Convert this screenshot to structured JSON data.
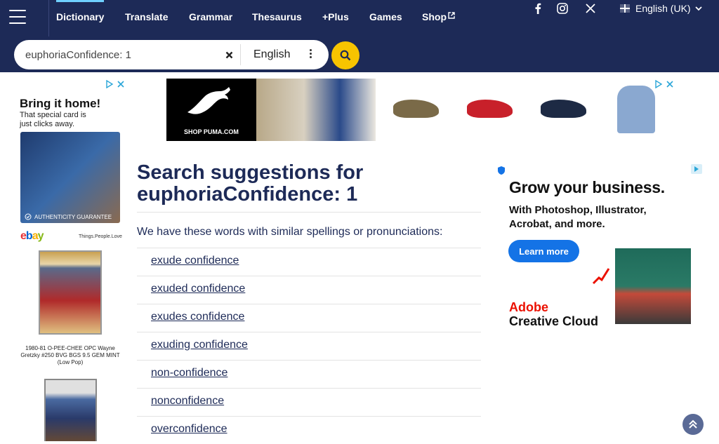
{
  "nav": {
    "items": [
      "Dictionary",
      "Translate",
      "Grammar",
      "Thesaurus",
      "+Plus",
      "Games",
      "Shop"
    ],
    "language": "English (UK)"
  },
  "search": {
    "value": "euphoriaConfidence: 1",
    "language": "English"
  },
  "ads": {
    "left": {
      "headline": "Bring it home!",
      "sub": "That special card is just clicks away.",
      "badge": "AUTHENTICITY GUARANTEE",
      "brand": "ebay",
      "tagline": "Things.People.Love",
      "caption": "1980-81 O-PEE-CHEE OPC Wayne Gretzky #250 BVG BGS 9.5 GEM MINT (Low Pop)"
    },
    "top": {
      "brand_text": "SHOP PUMA.COM"
    },
    "right": {
      "headline": "Grow your business.",
      "sub": "With Photoshop, Illustrator, Acrobat, and more.",
      "button": "Learn more",
      "brand_line1": "Adobe",
      "brand_line2": "Creative Cloud"
    }
  },
  "main": {
    "title_prefix": "Search suggestions for",
    "title_query": "euphoriaConfidence: 1",
    "intro": "We have these words with similar spellings or pronunciations:",
    "suggestions": [
      "exude confidence",
      "exuded confidence",
      "exudes confidence",
      "exuding confidence",
      "non-confidence",
      "nonconfidence",
      "overconfidence"
    ]
  },
  "colors": {
    "header_bg": "#1d2a57",
    "search_button": "#f7c400",
    "link": "#1d2a57"
  }
}
